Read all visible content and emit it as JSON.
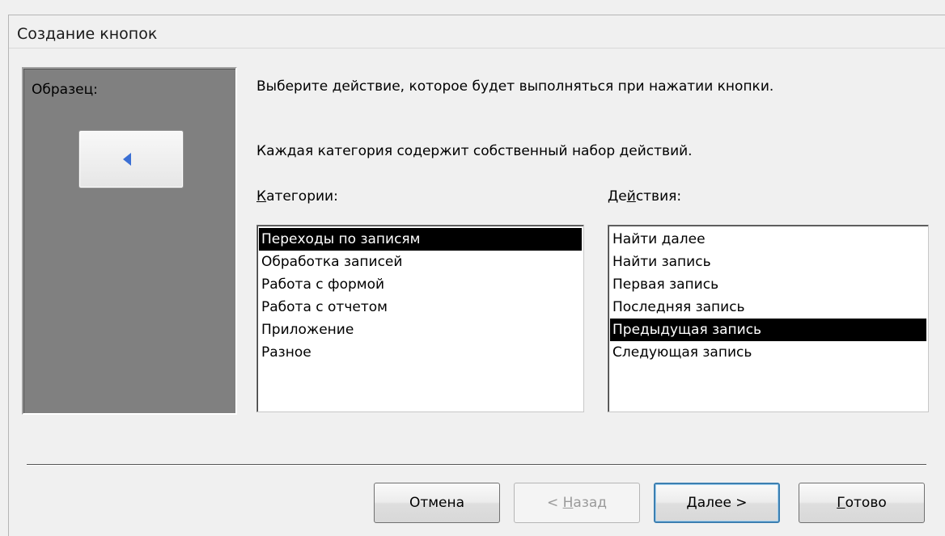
{
  "window": {
    "title": "Создание кнопок"
  },
  "sample": {
    "label": "Образец:",
    "button_icon": "left-triangle-icon"
  },
  "instructions": {
    "line1": "Выберите действие, которое будет выполняться при нажатии кнопки.",
    "line2": "Каждая категория содержит собственный набор действий."
  },
  "categories": {
    "label_pre": "",
    "label_hot": "К",
    "label_post": "атегории:",
    "items": [
      "Переходы по записям",
      "Обработка записей",
      "Работа с формой",
      "Работа с отчетом",
      "Приложение",
      "Разное"
    ],
    "selected_index": 0
  },
  "actions": {
    "label_pre": "Де",
    "label_hot": "й",
    "label_post": "ствия:",
    "items": [
      "Найти далее",
      "Найти запись",
      "Первая запись",
      "Последняя запись",
      "Предыдущая запись",
      "Следующая запись"
    ],
    "selected_index": 4
  },
  "buttons": {
    "cancel": "Отмена",
    "back_pre": "< ",
    "back_hot": "Н",
    "back_post": "азад",
    "next_hot": "Д",
    "next_post": "алее >",
    "finish_hot": "Г",
    "finish_post": "отово"
  }
}
